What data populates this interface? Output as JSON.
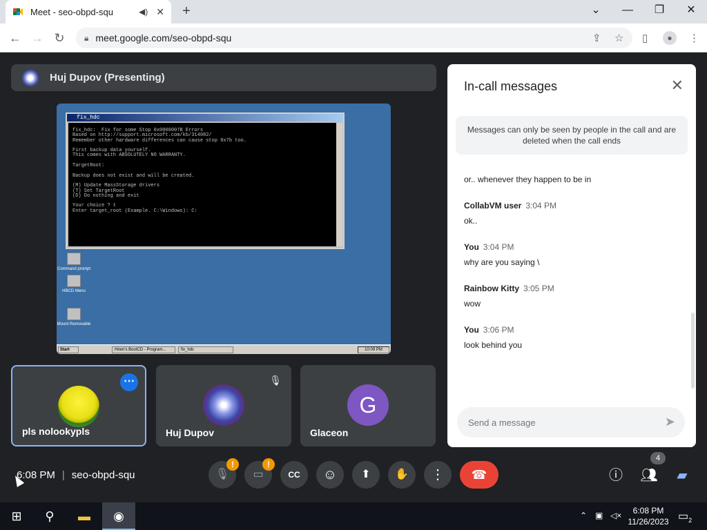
{
  "browser": {
    "tab_title": "Meet - seo-obpd-squ",
    "url": "meet.google.com/seo-obpd-squ",
    "tab_audio_icon": "speaker-icon",
    "tab_close": "✕",
    "new_tab": "+"
  },
  "meet": {
    "presenter": "Huj Dupov (Presenting)",
    "shared_screen": {
      "window_title": "fix_hdc",
      "console_lines": "fix_hdc:  Fix for some Stop 0x0000007B Errors\nBased on http://support.microsoft.com/kb/314082/\nRemember other hardware differences can cause stop 0x7b too.\n\nFirst backup data yourself.\nThis comes with ABSOLUTELY NO WARRANTY.\n\nTargetRoot:\n\nBackup does not exist and will be created.\n\n(M) Update MassStorage drivers\n(T) Set TargetRoot\n(D) Do nothing and exit\n\nYour choice ? t\nEnter target_root (Example. C:\\Windows): C:",
      "desktop_icons": [
        "Command prompt",
        "HBCD Menu",
        "Mount Removable"
      ],
      "taskbar": {
        "start": "Start",
        "tasks": [
          "Hiren's BootCD - Program...",
          "fix_hdc"
        ],
        "clock": "10:09 PM"
      }
    },
    "participants": [
      {
        "name": "pls nolookypls",
        "avatar": "smiley-avatar"
      },
      {
        "name": "Huj Dupov",
        "avatar": "snowflake-avatar"
      },
      {
        "name": "Glaceon",
        "initial": "G"
      }
    ],
    "meeting_time": "6:08 PM",
    "meeting_code": "seo-obpd-squ",
    "people_count": "4"
  },
  "chat": {
    "title": "In-call messages",
    "notice": "Messages can only be seen by people in the call and are deleted when the call ends",
    "messages": [
      {
        "author": "",
        "time": "",
        "text": "or.. whenever they happen to be in"
      },
      {
        "author": "CollabVM user",
        "time": "3:04 PM",
        "text": "ok.."
      },
      {
        "author": "You",
        "time": "3:04 PM",
        "text": "why are you saying \\"
      },
      {
        "author": "Rainbow Kitty",
        "time": "3:05 PM",
        "text": "wow"
      },
      {
        "author": "You",
        "time": "3:06 PM",
        "text": "look behind you"
      }
    ],
    "placeholder": "Send a message"
  },
  "taskbar": {
    "time": "6:08 PM",
    "date": "11/26/2023",
    "notifications": "2"
  },
  "colors": {
    "meet_bg": "#202124",
    "accent_blue": "#1a73e8",
    "hangup_red": "#ea4335",
    "warning_orange": "#f29900"
  }
}
